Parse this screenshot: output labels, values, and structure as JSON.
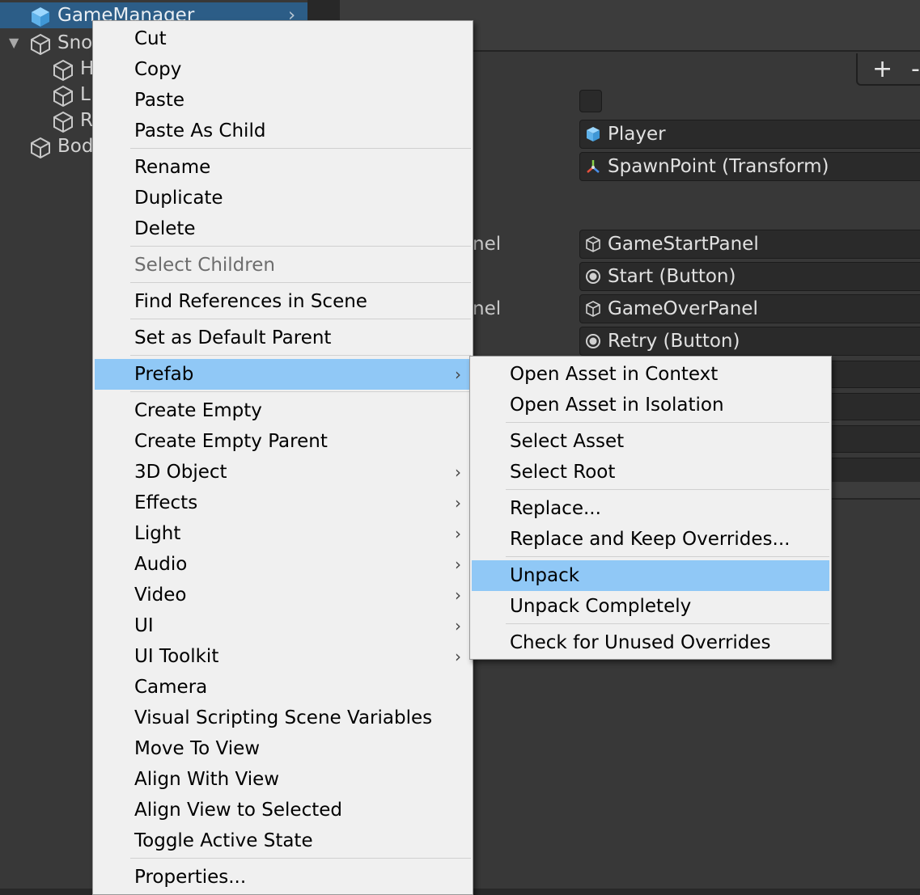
{
  "hierarchy": {
    "items": [
      {
        "label": "GameManager",
        "selected": true
      },
      {
        "label": "Sno"
      },
      {
        "label": "H"
      },
      {
        "label": "L"
      },
      {
        "label": "R"
      },
      {
        "label": "Bod"
      }
    ],
    "selected_arrow": "›",
    "foldout": "▼"
  },
  "inspector": {
    "add_button": "+",
    "remove_button": "-",
    "label_fragment_1": "nel",
    "label_fragment_2": "nel",
    "fields": {
      "player": "Player",
      "spawn_point": "SpawnPoint (Transform)",
      "game_start_panel": "GameStartPanel",
      "start_button": "Start (Button)",
      "game_over_panel": "GameOverPanel",
      "retry_button": "Retry (Button)"
    }
  },
  "context_menu": {
    "cut": "Cut",
    "copy": "Copy",
    "paste": "Paste",
    "paste_as_child": "Paste As Child",
    "rename": "Rename",
    "duplicate": "Duplicate",
    "delete": "Delete",
    "select_children": "Select Children",
    "find_references": "Find References in Scene",
    "set_default_parent": "Set as Default Parent",
    "prefab": "Prefab",
    "create_empty": "Create Empty",
    "create_empty_parent": "Create Empty Parent",
    "object_3d": "3D Object",
    "effects": "Effects",
    "light": "Light",
    "audio": "Audio",
    "video": "Video",
    "ui": "UI",
    "ui_toolkit": "UI Toolkit",
    "camera": "Camera",
    "visual_scripting": "Visual Scripting Scene Variables",
    "move_to_view": "Move To View",
    "align_with_view": "Align With View",
    "align_view_to_selected": "Align View to Selected",
    "toggle_active_state": "Toggle Active State",
    "properties": "Properties...",
    "submenu_arrow": "›"
  },
  "prefab_submenu": {
    "open_in_context": "Open Asset in Context",
    "open_in_isolation": "Open Asset in Isolation",
    "select_asset": "Select Asset",
    "select_root": "Select Root",
    "replace": "Replace...",
    "replace_keep_overrides": "Replace and Keep Overrides...",
    "unpack": "Unpack",
    "unpack_completely": "Unpack Completely",
    "check_unused_overrides": "Check for Unused Overrides"
  },
  "colors": {
    "menu_highlight": "#90c8f6",
    "hierarchy_selection": "#2c5d87",
    "menu_background": "#f0f0f0",
    "editor_background": "#383838"
  }
}
